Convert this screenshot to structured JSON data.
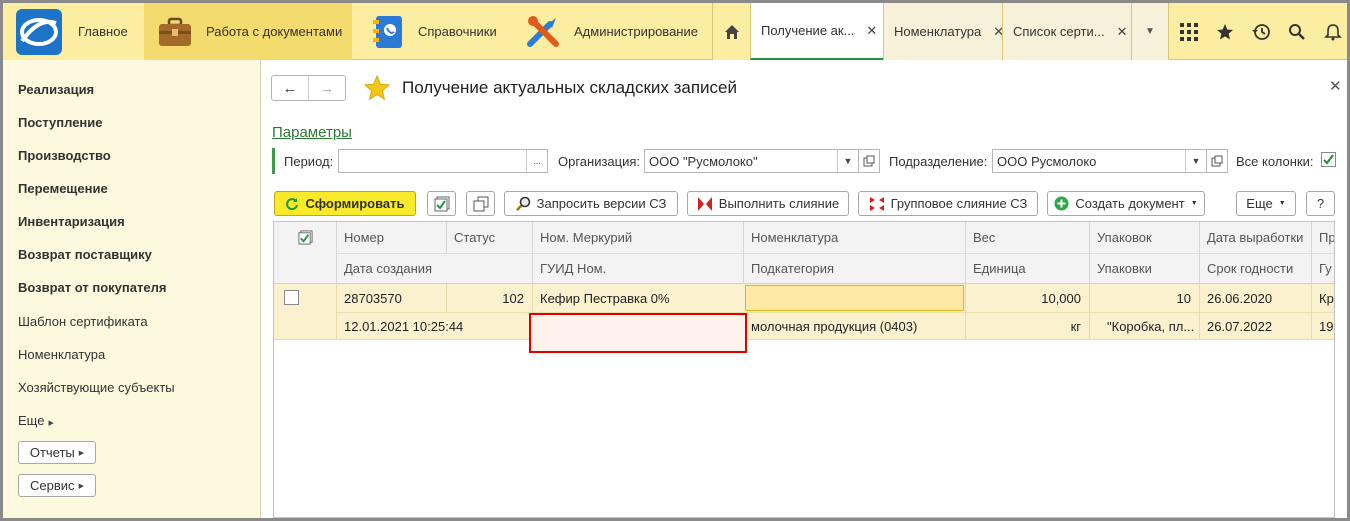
{
  "topbar": {
    "sections": [
      "Главное",
      "Работа с документами",
      "Справочники",
      "Администрирование"
    ],
    "tabs": [
      {
        "label": "Получение ак...",
        "active": true
      },
      {
        "label": "Номенклатура",
        "active": false
      },
      {
        "label": "Список серти...",
        "active": false
      }
    ],
    "icons": [
      "home-icon",
      "grid-icon",
      "star-icon",
      "history-icon",
      "search-icon",
      "bell-icon"
    ]
  },
  "sidebar": {
    "bold_items": [
      "Реализация",
      "Поступление",
      "Производство",
      "Перемещение",
      "Инвентаризация",
      "Возврат поставщику",
      "Возврат от покупателя"
    ],
    "items": [
      "Шаблон сертификата",
      "Номенклатура",
      "Хозяйствующие субъекты"
    ],
    "more": "Еще",
    "buttons": [
      "Отчеты",
      "Сервис"
    ]
  },
  "form": {
    "title": "Получение актуальных складских записей",
    "params_link": "Параметры",
    "period_label": "Период:",
    "period_value": "",
    "period_btn": "...",
    "org_label": "Организация:",
    "org_value": "ООО \"Русмолоко\"",
    "dept_label": "Подразделение:",
    "dept_value": "ООО Русмолоко",
    "all_columns_label": "Все колонки:",
    "all_columns_checked": true
  },
  "toolbar": {
    "generate": "Сформировать",
    "request_versions": "Запросить версии СЗ",
    "merge": "Выполнить слияние",
    "group_merge": "Групповое слияние СЗ",
    "create_doc": "Создать документ",
    "more": "Еще",
    "help": "?"
  },
  "table": {
    "header_row1": [
      "Номер",
      "Статус",
      "Ном. Меркурий",
      "Номенклатура",
      "Вес",
      "Упаковок",
      "Дата выработки",
      "Пр"
    ],
    "header_row2": [
      "Дата создания",
      "ГУИД Ном.",
      "Подкатегория",
      "Единица",
      "Упаковки",
      "Срок годности",
      "Гу"
    ],
    "rows": [
      {
        "number": "28703570",
        "status": "102",
        "mercury_nom": "Кефир Пестравка 0%",
        "nomenclature": "",
        "weight": "10,000",
        "packages": "10",
        "production_date": "26.06.2020",
        "pr": "Кр",
        "created": "12.01.2021 10:25:44",
        "guid": "",
        "subcategory": "молочная продукция (0403)",
        "unit": "кг",
        "packaging": "\"Коробка, пл...",
        "expiry": "26.07.2022",
        "gu": "19"
      }
    ]
  }
}
